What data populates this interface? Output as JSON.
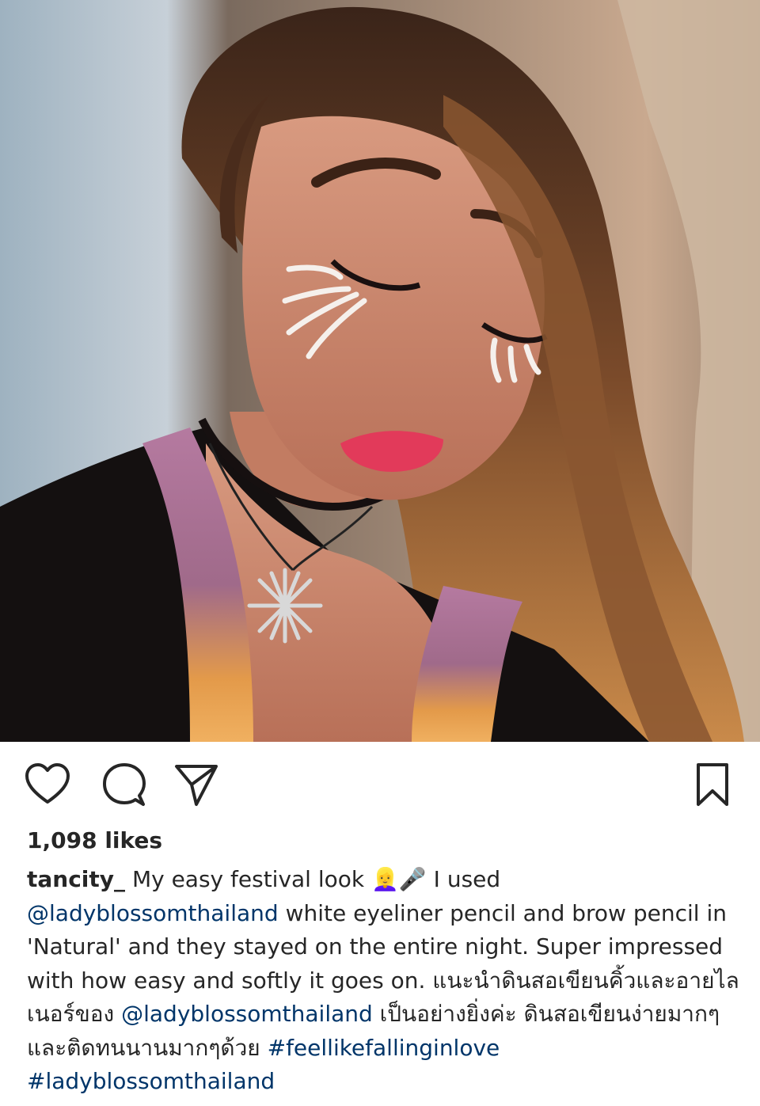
{
  "post": {
    "image_alt": "Selfie of a woman with white eyeliner festival makeup",
    "likes": "1,098 likes",
    "username": "tancity_",
    "caption": {
      "line1_text": " My easy festival look ",
      "emoji_1": "👱‍♀️",
      "emoji_2": "🎤",
      "line1_end": " I used",
      "mention_1": "@ladyblossomthailand",
      "text_2": " white eyeliner pencil and brow pencil in 'Natural' and they stayed on the entire night. Super impressed with how easy and softly it goes on. แนะนำดินสอเขียนคิ้วและอายไลเนอร์ของ ",
      "mention_2": "@ladyblossomthailand",
      "text_3": " เป็นอย่างยิ่งค่ะ ดินสอเขียนง่ายมากๆ และติดทนนานมากๆด้วย ",
      "hashtag_1": "#feellikefallinginlove",
      "hashtag_2": "#ladyblossomthailand"
    }
  },
  "colors": {
    "text": "#262626",
    "link": "#003569",
    "background": "#ffffff"
  },
  "icons": [
    "heart-icon",
    "comment-icon",
    "share-icon",
    "bookmark-icon"
  ]
}
